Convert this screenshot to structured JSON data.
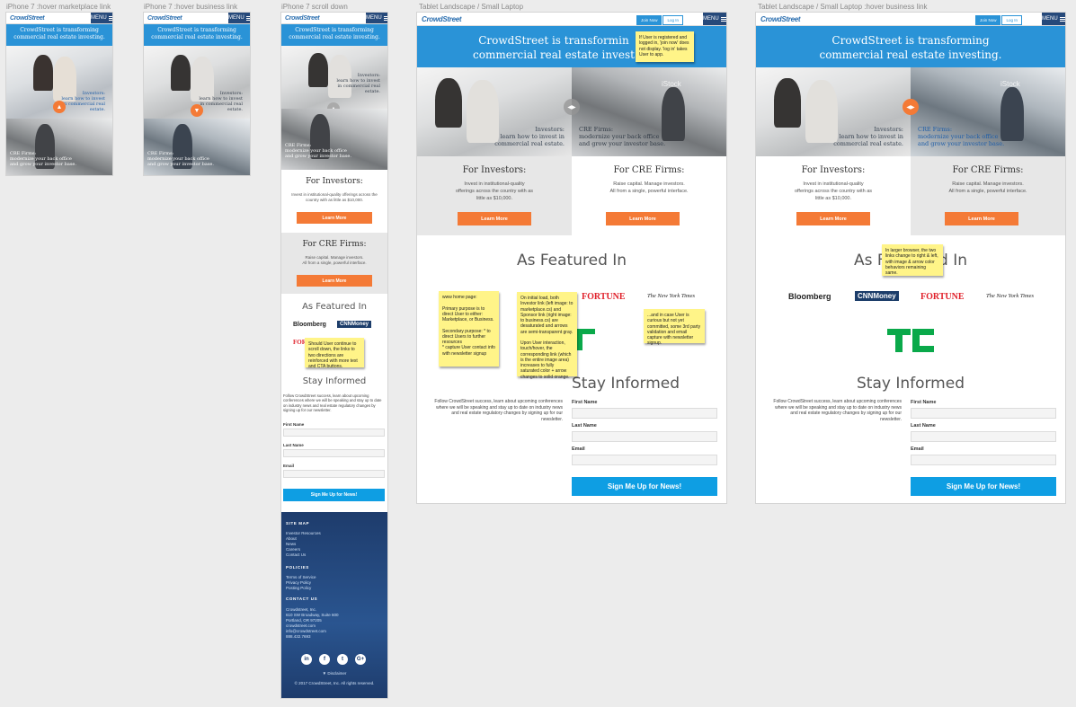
{
  "artboards": {
    "a1": "iPhone 7 :hover marketplace link",
    "a2": "iPhone 7 :hover business link",
    "a3": "iPhone 7 scroll down",
    "a4": "Tablet Landscape / Small Laptop",
    "a5": "Tablet Landscape / Small Laptop :hover business link"
  },
  "site": {
    "logo": "CrowdStreet",
    "menu": "MENU",
    "join": "Join Now",
    "login": "Log In",
    "hero_line1": "CrowdStreet is transforming",
    "hero_line2": "commercial real estate investing.",
    "hero_line1_cut": "CrowdStreet is transformin",
    "hero_line2_cut": "commercial real estate invest",
    "investors_cap1": "Investors:",
    "investors_cap2": "learn how to invest in",
    "investors_cap3": "commercial real estate.",
    "mobile_inv_cap2": "learn how to invest",
    "mobile_inv_cap3": "in commercial real",
    "mobile_inv_cap4": "estate.",
    "cre_cap1": "CRE Firms:",
    "cre_cap2": "modernize your back office",
    "cre_cap3": "and grow your investor base.",
    "istock": "iStock",
    "for_investors": "For Investors:",
    "investors_text1": "Invest in institutional-quality",
    "investors_text2": "offerings across the country with as",
    "investors_text3": "little as $10,000.",
    "mobile_inv_text1": "Invest in institutional-quality offerings across the",
    "mobile_inv_text2": "country with as little as $10,000.",
    "for_cre": "For CRE Firms:",
    "cre_text1": "Raise capital. Manage investors.",
    "cre_text2": "All from a single, powerful interface.",
    "learn_more": "Learn More",
    "featured": "As Featured In",
    "featured_cut": "As F",
    "featured_cut2": "d In",
    "bloomberg": "Bloomberg",
    "cnnmoney": "CNNMoney",
    "fortune": "FORTUNE",
    "nyt": "The New York Times",
    "stay": "Stay Informed",
    "stay_text1": "Follow CrowdStreet success, learn about upcoming conferences",
    "stay_text2": "where we will be speaking and stay up to date on industry news",
    "stay_text3": "and real estate regulatory changes by signing up for our",
    "stay_text4": "newsletter.",
    "mobile_stay_text": "Follow CrowdStreet success, learn about upcoming conferences where we will be speaking and stay up to date on industry news and real estate regulatory changes by signing up for our newsletter.",
    "first_name": "First Name",
    "last_name": "Last Name",
    "email": "Email",
    "signup": "Sign Me Up for News!"
  },
  "footer": {
    "site_map": "SITE MAP",
    "site_map_links": "Investor Resources\nAbout\nNews\nCareers\nContact Us",
    "policies": "POLICIES",
    "policies_links": "Terms of Service\nPrivacy Policy\nPosting Policy",
    "contact": "CONTACT US",
    "contact_text": "Crowdstreet, Inc.\n610 SW Broadway, Suite 600\nPortland, OR 97205\ncrowdstreet.com\ninfo@crowdstreet.com\n888.432.7693",
    "social_in": "in",
    "social_f": "f",
    "social_t": "t",
    "social_g": "G+",
    "disclaimer": "▼ Disclaimer",
    "copyright": "© 2017 CrowdStreet, Inc. All rights reserved."
  },
  "notes": {
    "login_note": "If User is registered and logged in, 'join now' does not display. 'log in' takes User to app.",
    "home_note": "www home page:\n\nPrimary purpose is to direct User to either: Marketplace, or Business.\n\nSecondary purpose: * to direct Users to further resources\n* capture User contact info with newsletter signup",
    "initial_note": "On initial load, both Investor link (left image: to marketplace.cs) and Sponsor link (right image: to business.cs) are desaturated and arrows are semi-transparent gray.\n\nUpon User interaction, touch/hover, the corresponding link (which is the entire image area) increases to fully saturated color + arrow changes to solid orange.",
    "curious_note": "...and in case User is curious but not yet committed, some 3rd party validation and email capture with newsletter signup.",
    "scroll_note": "Should User continue to scroll down, the links to two directions are reinforced with more text and CTA buttons.",
    "larger_note": "In larger browser, the two links change to right & left, with image & arrow color behaviors remaining same."
  },
  "colors": {
    "brand_blue": "#2a93d7",
    "cta_orange": "#f47a36",
    "signup_blue": "#0e9ee3",
    "navy": "#26497a",
    "tc_green": "#0aa94a",
    "fortune_red": "#e0202a",
    "note_yellow": "#fff488"
  }
}
